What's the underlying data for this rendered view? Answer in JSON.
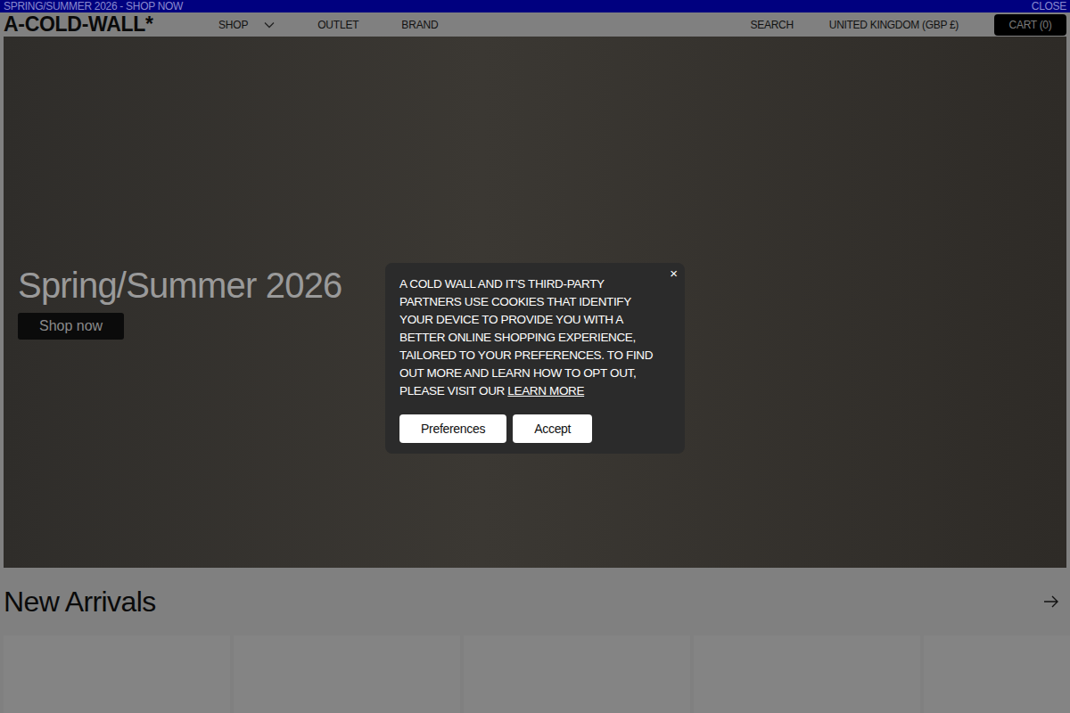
{
  "announcement": {
    "text": "SPRING/SUMMER 2026 - SHOP NOW",
    "close": "CLOSE"
  },
  "header": {
    "logo": "A-COLD-WALL*",
    "nav": [
      {
        "label": "SHOP",
        "dropdown": true
      },
      {
        "label": "OUTLET",
        "dropdown": false
      },
      {
        "label": "BRAND",
        "dropdown": false
      }
    ],
    "search": "SEARCH",
    "region": "UNITED KINGDOM (GBP £)",
    "cart": "CART (0)"
  },
  "hero": {
    "title": "Spring/Summer 2026",
    "button": "Shop now"
  },
  "new_arrivals": {
    "title": "New Arrivals",
    "cards": [
      {
        "loaded": false
      },
      {
        "loaded": false
      },
      {
        "loaded": false
      },
      {
        "loaded": false
      },
      {
        "loaded": false
      }
    ]
  },
  "cookie_banner": {
    "text": "A COLD WALL AND IT'S THIRD-PARTY PARTNERS USE COOKIES THAT IDENTIFY YOUR DEVICE TO PROVIDE YOU WITH A BETTER ONLINE SHOPPING EXPERIENCE, TAILORED TO YOUR PREFERENCES. TO FIND OUT MORE AND LEARN HOW TO OPT OUT, PLEASE VISIT OUR",
    "link": "LEARN MORE",
    "close": "×",
    "buttons": [
      "Preferences",
      "Accept"
    ]
  }
}
